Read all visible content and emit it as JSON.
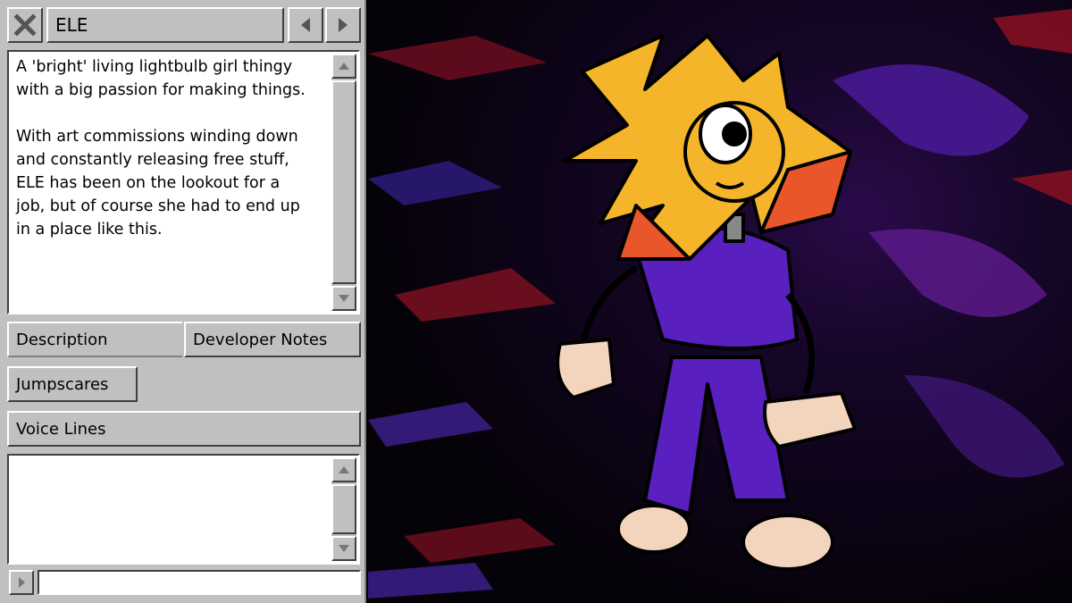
{
  "character": {
    "name": "ELE",
    "description": "A 'bright' living lightbulb girl thingy\nwith a big passion for making things.\n\nWith art commissions winding down\nand constantly releasing free stuff,\nELE has been on the lookout for a\njob, but of course she had to end up\nin a place like this."
  },
  "tabs": {
    "description": "Description",
    "developer_notes": "Developer Notes",
    "jumpscares": "Jumpscares",
    "voice_lines": "Voice Lines"
  },
  "icons": {
    "close": "close-icon",
    "prev": "left-arrow-icon",
    "next": "right-arrow-icon",
    "scroll_up": "up-arrow-icon",
    "scroll_down": "down-arrow-icon",
    "play": "right-arrow-icon"
  },
  "colors": {
    "panel": "#c0c0c0",
    "background": "#000000",
    "hair_yellow": "#f5b52a",
    "hair_orange": "#e8562a",
    "outfit_purple": "#5a1fbf"
  }
}
